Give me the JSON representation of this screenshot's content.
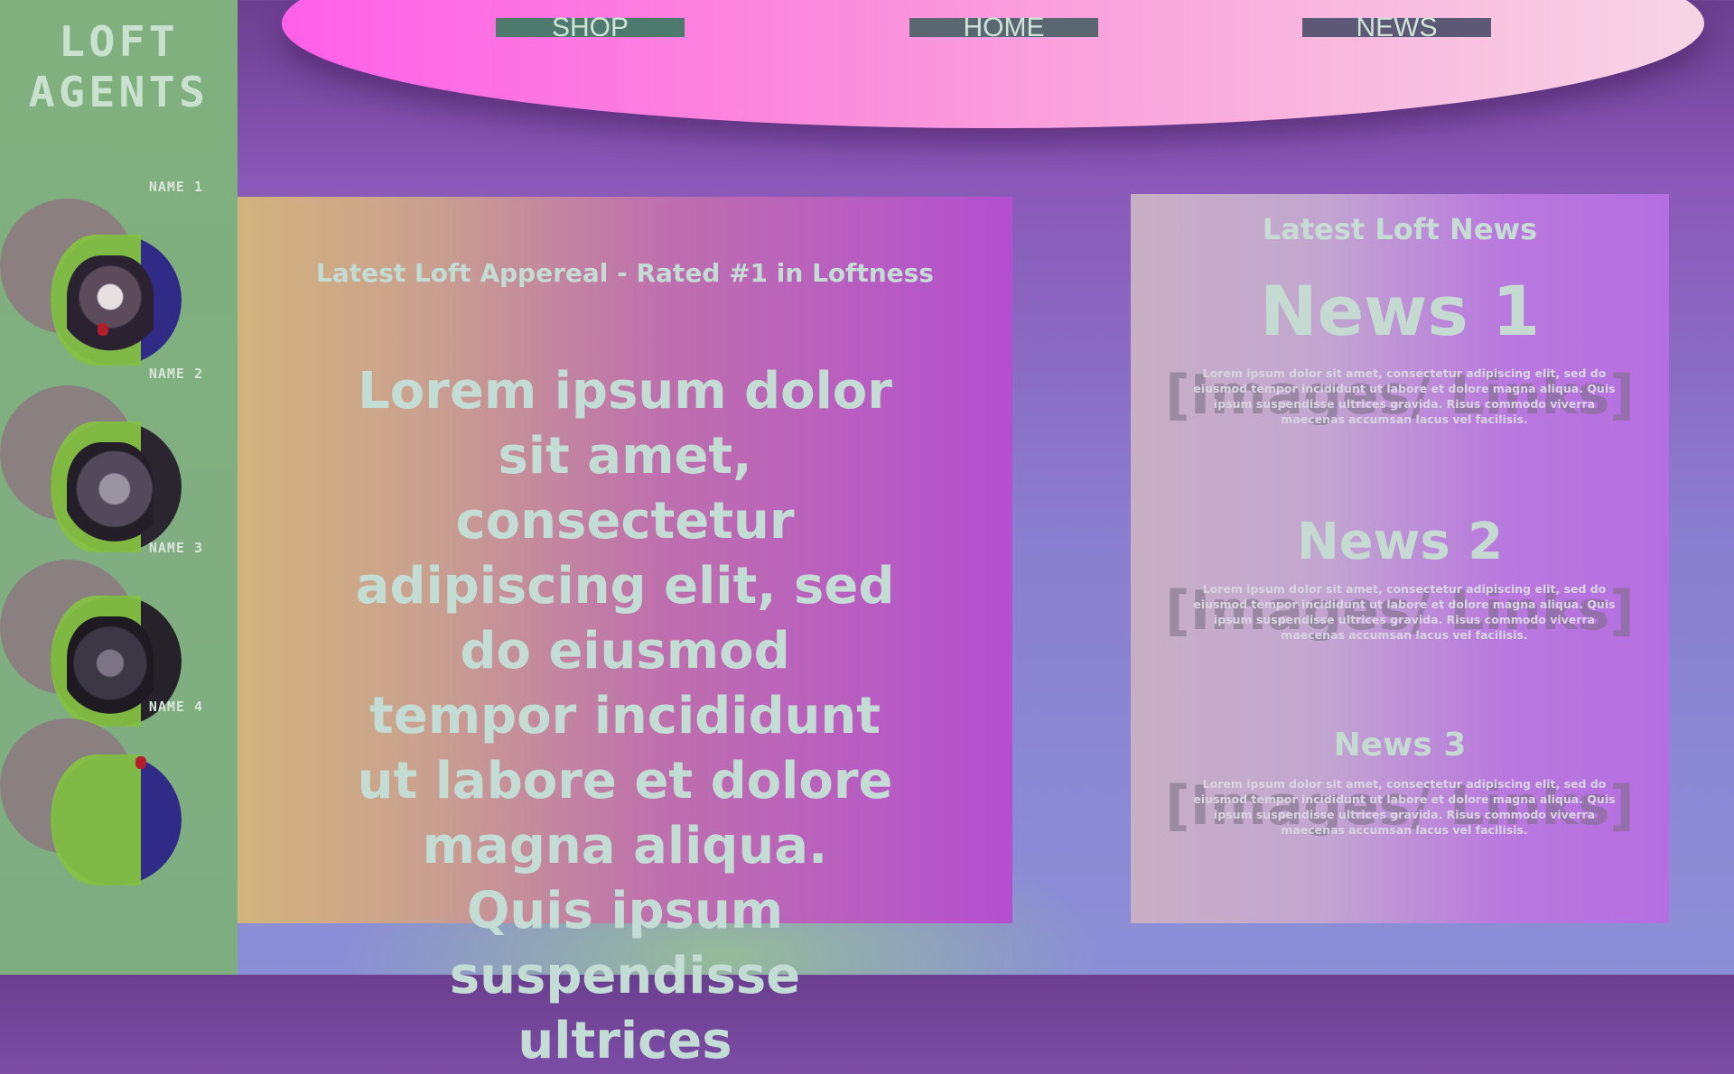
{
  "logo": {
    "line1": "LOFT",
    "line2": "AGENTS"
  },
  "agents": [
    {
      "name": "NAME 1"
    },
    {
      "name": "NAME 2"
    },
    {
      "name": "NAME 3"
    },
    {
      "name": "NAME 4"
    }
  ],
  "nav": {
    "shop": "SHOP",
    "home": "HOME",
    "news": "NEWS"
  },
  "main": {
    "title": "Latest Loft Appereal - Rated #1 in Loftness",
    "body": "Lorem ipsum dolor sit amet, consectetur adipiscing elit, sed do eiusmod tempor incididunt ut labore et dolore magna aliqua. Quis ipsum suspendisse ultrices"
  },
  "news": {
    "heading": "Latest Loft News",
    "items": [
      {
        "title": "News 1",
        "placeholder": "[Images/ Links]",
        "text": "Lorem ipsum dolor sit amet, consectetur adipiscing elit, sed do eiusmod tempor incididunt ut labore et dolore magna aliqua. Quis ipsum suspendisse ultrices gravida. Risus commodo viverra maecenas accumsan lacus vel facilisis."
      },
      {
        "title": "News 2",
        "placeholder": "[Images/ Links]",
        "text": "Lorem ipsum dolor sit amet, consectetur adipiscing elit, sed do eiusmod tempor incididunt ut labore et dolore magna aliqua. Quis ipsum suspendisse ultrices gravida. Risus commodo viverra maecenas accumsan lacus vel facilisis."
      },
      {
        "title": "News 3",
        "placeholder": "[Images/ Links]",
        "text": "Lorem ipsum dolor sit amet, consectetur adipiscing elit, sed do eiusmod tempor incididunt ut labore et dolore magna aliqua. Quis ipsum suspendisse ultrices gravida. Risus commodo viverra maecenas accumsan lacus vel facilisis."
      }
    ]
  },
  "colors": {
    "sidebar": "#80b07e",
    "text_mint": "#c3ddd5",
    "nav_pink": "#ff5fe8",
    "agent_blue": "#2f2b87",
    "agent_green": "#84c142"
  }
}
